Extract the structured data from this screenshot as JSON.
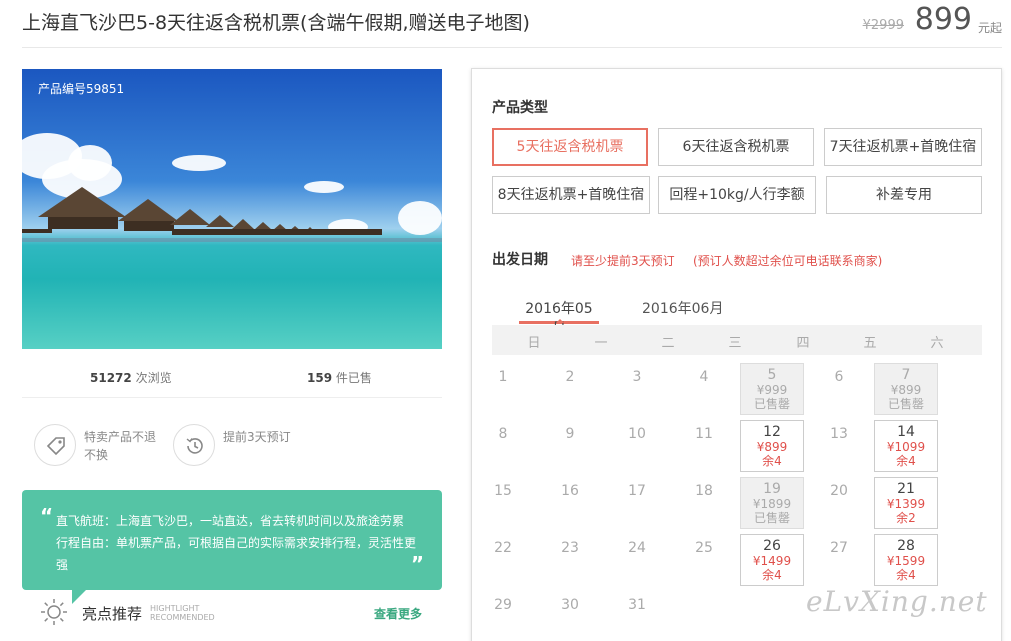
{
  "header": {
    "title": "上海直飞沙巴5-8天往返含税机票(含端午假期,赠送电子地图)",
    "price_old": "¥2999",
    "price": "899",
    "price_unit": "元起"
  },
  "photo": {
    "product_id": "产品编号59851"
  },
  "stats": {
    "views_num": "51272",
    "views_label": "次浏览",
    "sold_num": "159",
    "sold_label": "件已售"
  },
  "features": [
    {
      "icon": "tag-icon",
      "text": "特卖产品不退不换"
    },
    {
      "icon": "clock-history-icon",
      "text": "提前3天预订"
    }
  ],
  "bubble": {
    "line1": "直飞航班：上海直飞沙巴，一站直达，省去转机时间以及旅途劳累",
    "line2": "行程自由：单机票产品，可根据自己的实际需求安排行程，灵活性更强"
  },
  "highlights": {
    "title": "亮点推荐",
    "en1": "HIGHTLIGHT",
    "en2": "RECOMMENDED",
    "more": "查看更多"
  },
  "product_type": {
    "title": "产品类型",
    "options": [
      "5天往返含税机票",
      "6天往返含税机票",
      "7天往返机票+首晚住宿",
      "8天往返机票+首晚住宿",
      "回程+10kg/人行李额",
      "补差专用"
    ],
    "selected_index": 0
  },
  "departure": {
    "title": "出发日期",
    "note1": "请至少提前3天预订",
    "note2": "(预订人数超过余位可电话联系商家)"
  },
  "months": [
    "2016年05月",
    "2016年06月"
  ],
  "weekdays": [
    "日",
    "一",
    "二",
    "三",
    "四",
    "五",
    "六"
  ],
  "calendar": {
    "weeks": [
      [
        {
          "d": "1"
        },
        {
          "d": "2"
        },
        {
          "d": "3"
        },
        {
          "d": "4"
        },
        {
          "d": "5",
          "p": "¥999",
          "r": "已售罄",
          "s": "soldout"
        },
        {
          "d": "6"
        },
        {
          "d": "7",
          "p": "¥899",
          "r": "已售罄",
          "s": "soldout"
        }
      ],
      [
        {
          "d": "8"
        },
        {
          "d": "9"
        },
        {
          "d": "10"
        },
        {
          "d": "11"
        },
        {
          "d": "12",
          "p": "¥899",
          "r": "余4",
          "s": "avail"
        },
        {
          "d": "13"
        },
        {
          "d": "14",
          "p": "¥1099",
          "r": "余4",
          "s": "avail"
        }
      ],
      [
        {
          "d": "15"
        },
        {
          "d": "16"
        },
        {
          "d": "17"
        },
        {
          "d": "18"
        },
        {
          "d": "19",
          "p": "¥1899",
          "r": "已售罄",
          "s": "soldout"
        },
        {
          "d": "20"
        },
        {
          "d": "21",
          "p": "¥1399",
          "r": "余2",
          "s": "avail"
        }
      ],
      [
        {
          "d": "22"
        },
        {
          "d": "23"
        },
        {
          "d": "24"
        },
        {
          "d": "25"
        },
        {
          "d": "26",
          "p": "¥1499",
          "r": "余4",
          "s": "avail"
        },
        {
          "d": "27"
        },
        {
          "d": "28",
          "p": "¥1599",
          "r": "余4",
          "s": "avail"
        }
      ],
      [
        {
          "d": "29"
        },
        {
          "d": "30"
        },
        {
          "d": "31"
        }
      ]
    ]
  },
  "watermark": "eLvXing.net",
  "colors": {
    "accent": "#e87061",
    "bubble": "#55c4a5",
    "link": "#3aa880",
    "price_red": "#e0504b"
  }
}
